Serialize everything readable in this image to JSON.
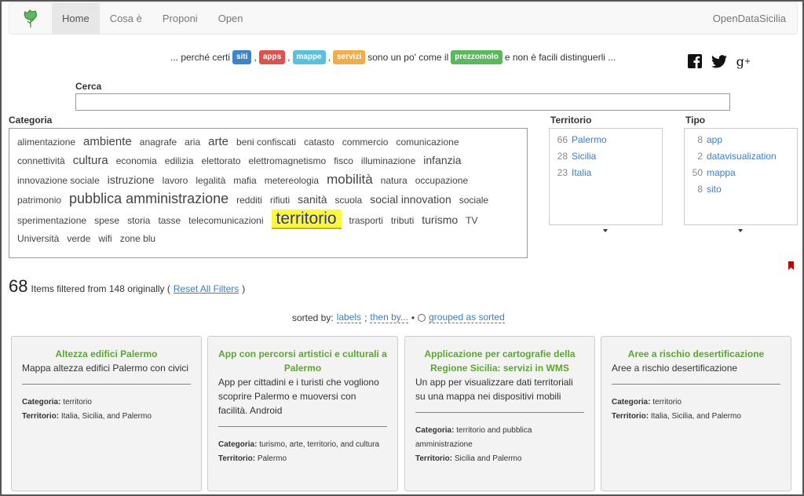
{
  "navbar": {
    "logo_icon": "leaf-icon",
    "items": [
      {
        "label": "Home",
        "active": true
      },
      {
        "label": "Cosa è",
        "active": false
      },
      {
        "label": "Proponi",
        "active": false
      },
      {
        "label": "Open",
        "active": false
      }
    ],
    "brand": "OpenDataSicilia"
  },
  "tagline": {
    "prefix": "... perché certi",
    "badges": [
      {
        "label": "siti",
        "color": "#3c85c4"
      },
      {
        "label": "apps",
        "color": "#d9534f"
      },
      {
        "label": "mappe",
        "color": "#5bc0de"
      },
      {
        "label": "servizi",
        "color": "#f0ad4e"
      }
    ],
    "middle": "sono un po' come il",
    "badge_prezzomolo": {
      "label": "prezzomolo",
      "color": "#5cb85c"
    },
    "suffix": "e non è facili distinguerli ..."
  },
  "social": [
    "facebook-icon",
    "twitter-icon",
    "google-plus-icon"
  ],
  "search": {
    "label": "Cerca",
    "value": "",
    "placeholder": ""
  },
  "categoria": {
    "title": "Categoria",
    "tags": [
      {
        "label": "alimentazione",
        "size": 12
      },
      {
        "label": "ambiente",
        "size": 15
      },
      {
        "label": "anagrafe",
        "size": 12
      },
      {
        "label": "aria",
        "size": 12
      },
      {
        "label": "arte",
        "size": 15
      },
      {
        "label": "beni confiscati",
        "size": 12
      },
      {
        "label": "catasto",
        "size": 12
      },
      {
        "label": "commercio",
        "size": 12
      },
      {
        "label": "comunicazione",
        "size": 12
      },
      {
        "label": "connettività",
        "size": 12
      },
      {
        "label": "cultura",
        "size": 15
      },
      {
        "label": "economia",
        "size": 12
      },
      {
        "label": "edilizia",
        "size": 12
      },
      {
        "label": "elettorato",
        "size": 12
      },
      {
        "label": "elettromagnetismo",
        "size": 12
      },
      {
        "label": "fisco",
        "size": 12
      },
      {
        "label": "illuminazione",
        "size": 12
      },
      {
        "label": "infanzia",
        "size": 14
      },
      {
        "label": "innovazione sociale",
        "size": 12
      },
      {
        "label": "istruzione",
        "size": 14
      },
      {
        "label": "lavoro",
        "size": 12
      },
      {
        "label": "legalità",
        "size": 12
      },
      {
        "label": "mafia",
        "size": 12
      },
      {
        "label": "metereologia",
        "size": 12
      },
      {
        "label": "mobilità",
        "size": 17
      },
      {
        "label": "natura",
        "size": 12
      },
      {
        "label": "occupazione",
        "size": 12
      },
      {
        "label": "patrimonio",
        "size": 12
      },
      {
        "label": "pubblica amministrazione",
        "size": 18
      },
      {
        "label": "redditi",
        "size": 12
      },
      {
        "label": "rifiuti",
        "size": 12
      },
      {
        "label": "sanità",
        "size": 14
      },
      {
        "label": "scuola",
        "size": 12
      },
      {
        "label": "social innovation",
        "size": 14
      },
      {
        "label": "sociale",
        "size": 12
      },
      {
        "label": "sperimentazione",
        "size": 12
      },
      {
        "label": "spese",
        "size": 12
      },
      {
        "label": "storia",
        "size": 12
      },
      {
        "label": "tasse",
        "size": 12
      },
      {
        "label": "telecomunicazioni",
        "size": 12
      },
      {
        "label": "territorio",
        "size": 21,
        "highlight": true
      },
      {
        "label": "trasporti",
        "size": 12
      },
      {
        "label": "tributi",
        "size": 12
      },
      {
        "label": "turismo",
        "size": 14
      },
      {
        "label": "TV",
        "size": 12
      },
      {
        "label": "Università",
        "size": 12
      },
      {
        "label": "verde",
        "size": 12
      },
      {
        "label": "wifi",
        "size": 12
      },
      {
        "label": "zone blu",
        "size": 12
      }
    ]
  },
  "territorio": {
    "title": "Territorio",
    "items": [
      {
        "count": "66",
        "label": "Palermo"
      },
      {
        "count": "28",
        "label": "Sicilia"
      },
      {
        "count": "23",
        "label": "Italia"
      }
    ]
  },
  "tipo": {
    "title": "Tipo",
    "items": [
      {
        "count": "8",
        "label": "app"
      },
      {
        "count": "2",
        "label": "datavisualization"
      },
      {
        "count": "50",
        "label": "mappa"
      },
      {
        "count": "8",
        "label": "sito"
      }
    ]
  },
  "summary": {
    "count": "68",
    "text": "Items filtered from 148 originally (",
    "reset": "Reset All Filters",
    "close": ")"
  },
  "sorted": {
    "prefix": "sorted by:",
    "labels": "labels",
    "then": "then by...",
    "bullet": "•",
    "grouped": "grouped as sorted"
  },
  "cards": [
    {
      "title": "Altezza edifici Palermo",
      "desc": "Mappa altezza edifici Palermo con civici",
      "categoria_label": "Categoria:",
      "categoria": "territorio",
      "territorio_label": "Territorio:",
      "territorio": "Italia, Sicilia, and Palermo"
    },
    {
      "title": "App con percorsi artistici e culturali a Palermo",
      "desc": "App per cittadini e i turisti che vogliono scoprire Palermo e muoversi con facilità. Android",
      "categoria_label": "Categoria:",
      "categoria": "turismo, arte, territorio, and cultura",
      "territorio_label": "Territorio:",
      "territorio": "Palermo"
    },
    {
      "title": "Applicazione per cartografie della Regione Sicilia: servizi in WMS",
      "desc": "Un app per visualizzare dati territoriali su una mappa nei dispositivi mobili",
      "categoria_label": "Categoria:",
      "categoria": "territorio and pubblica amministrazione",
      "territorio_label": "Territorio:",
      "territorio": "Sicilia and Palermo"
    },
    {
      "title": "Aree a rischio desertificazione",
      "desc": "Aree a rischio desertificazione",
      "categoria_label": "Categoria:",
      "categoria": "territorio",
      "territorio_label": "Territorio:",
      "territorio": "Italia, Sicilia, and Palermo"
    }
  ]
}
